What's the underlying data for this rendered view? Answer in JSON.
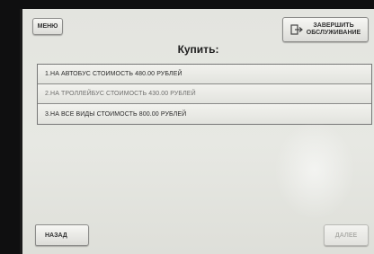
{
  "header": {
    "menu_label": "МЕНЮ",
    "end_service_label": "ЗАВЕРШИТЬ\nОБСЛУЖИВАНИЕ"
  },
  "title": "Купить:",
  "options": [
    {
      "label": "1.НА АВТОБУС СТОИМОСТЬ 480.00 РУБЛЕЙ"
    },
    {
      "label": "2.НА ТРОЛЛЕЙБУС СТОИМОСТЬ 430.00 РУБЛЕЙ"
    },
    {
      "label": "3.НА ВСЕ ВИДЫ СТОИМОСТЬ 800.00 РУБЛЕЙ"
    }
  ],
  "footer": {
    "back_label": "НАЗАД",
    "next_label": "ДАЛЕЕ"
  },
  "icons": {
    "end_service": "exit-icon"
  }
}
